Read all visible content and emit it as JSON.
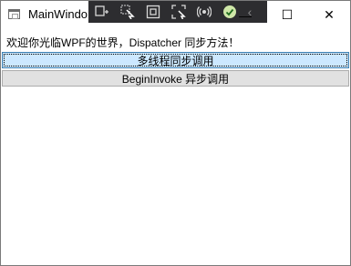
{
  "window": {
    "title": "MainWindow",
    "title_visible": "MainWindo"
  },
  "debug_toolbar": {
    "buttons": [
      {
        "icon": "live-visual-tree-icon"
      },
      {
        "icon": "select-element-icon"
      },
      {
        "icon": "display-layout-adorners-icon"
      },
      {
        "icon": "track-focus-icon"
      },
      {
        "icon": "hot-reload-icon"
      },
      {
        "icon": "binding-check-icon"
      },
      {
        "icon": "collapse-chevron-icon"
      }
    ]
  },
  "caption_buttons": {
    "minimize": "—",
    "maximize": "☐",
    "close": "✕"
  },
  "content": {
    "welcome_text": "欢迎你光临WPF的世界，Dispatcher 同步方法！",
    "sync_button_label": "多线程同步调用",
    "async_button_label": "BeginInvoke 异步调用"
  },
  "colors": {
    "focused_button_bg": "#cce8ff",
    "focused_button_border": "#3c7fb1",
    "button_bg": "#e1e1e1",
    "toolbar_bg": "#2d2d30"
  }
}
